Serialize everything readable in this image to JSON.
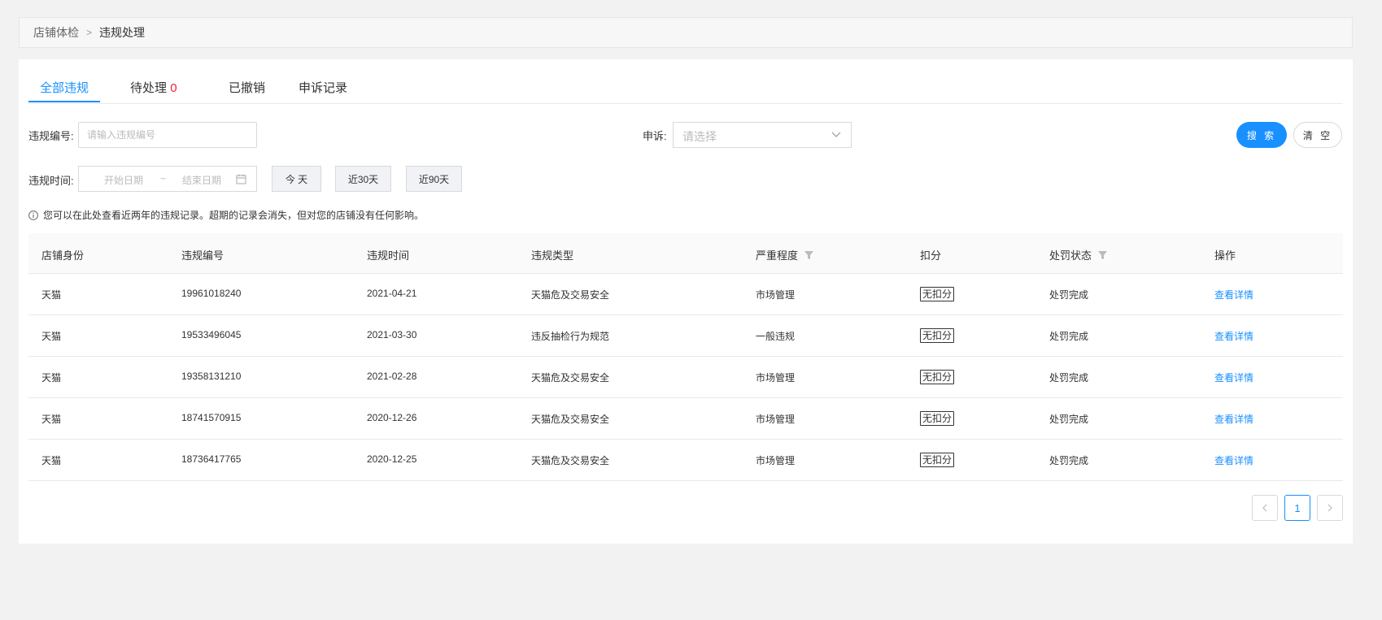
{
  "breadcrumb": {
    "parent": "店铺体检",
    "separator": ">",
    "current": "违规处理"
  },
  "tabs": [
    {
      "label": "全部违规",
      "count": ""
    },
    {
      "label": "待处理",
      "count": "0"
    },
    {
      "label": "已撤销",
      "count": ""
    },
    {
      "label": "申诉记录",
      "count": ""
    }
  ],
  "filters": {
    "violation_no_label": "违规编号:",
    "violation_no_placeholder": "请输入违规编号",
    "appeal_label": "申诉:",
    "appeal_placeholder": "请选择",
    "time_label": "违规时间:",
    "start_placeholder": "开始日期",
    "range_sep": "~",
    "end_placeholder": "结束日期",
    "quick_today": "今 天",
    "quick_30": "近30天",
    "quick_90": "近90天",
    "search": "搜 索",
    "clear": "清 空"
  },
  "notice": "您可以在此处查看近两年的违规记录。超期的记录会消失，但对您的店铺没有任何影响。",
  "table": {
    "headers": [
      "店铺身份",
      "违规编号",
      "违规时间",
      "违规类型",
      "严重程度",
      "扣分",
      "处罚状态",
      "操作"
    ],
    "rows": [
      [
        "天猫",
        "19961018240",
        "2021-04-21",
        "天猫危及交易安全",
        "市场管理",
        "无扣分",
        "处罚完成",
        "查看详情"
      ],
      [
        "天猫",
        "19533496045",
        "2021-03-30",
        "违反抽检行为规范",
        "一般违规",
        "无扣分",
        "处罚完成",
        "查看详情"
      ],
      [
        "天猫",
        "19358131210",
        "2021-02-28",
        "天猫危及交易安全",
        "市场管理",
        "无扣分",
        "处罚完成",
        "查看详情"
      ],
      [
        "天猫",
        "18741570915",
        "2020-12-26",
        "天猫危及交易安全",
        "市场管理",
        "无扣分",
        "处罚完成",
        "查看详情"
      ],
      [
        "天猫",
        "18736417765",
        "2020-12-25",
        "天猫危及交易安全",
        "市场管理",
        "无扣分",
        "处罚完成",
        "查看详情"
      ]
    ]
  },
  "pagination": {
    "current": "1"
  },
  "colors": {
    "accent": "#1890ff",
    "danger": "#f5222d"
  }
}
